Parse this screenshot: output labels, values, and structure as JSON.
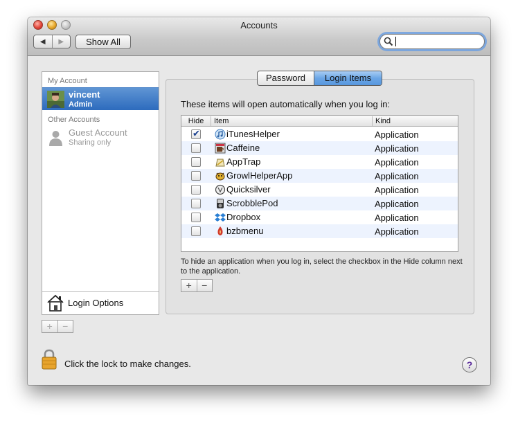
{
  "window": {
    "title": "Accounts"
  },
  "toolbar": {
    "back_icon": "◀",
    "forward_icon": "▶",
    "show_all_label": "Show All",
    "search_value": ""
  },
  "sidebar": {
    "my_account_header": "My Account",
    "current_user": {
      "name": "vincent",
      "role": "Admin"
    },
    "other_accounts_header": "Other Accounts",
    "guest": {
      "name": "Guest Account",
      "role": "Sharing only"
    },
    "login_options_label": "Login Options",
    "add_label": "+",
    "remove_label": "−"
  },
  "tabs": {
    "password": "Password",
    "login_items": "Login Items",
    "selected": "login_items"
  },
  "login_items": {
    "intro": "These items will open automatically when you log in:",
    "columns": {
      "hide": "Hide",
      "item": "Item",
      "kind": "Kind"
    },
    "rows": [
      {
        "hide": true,
        "name": "iTunesHelper",
        "kind": "Application",
        "icon": "itunes-helper-icon"
      },
      {
        "hide": false,
        "name": "Caffeine",
        "kind": "Application",
        "icon": "caffeine-icon"
      },
      {
        "hide": false,
        "name": "AppTrap",
        "kind": "Application",
        "icon": "apptrap-icon"
      },
      {
        "hide": false,
        "name": "GrowlHelperApp",
        "kind": "Application",
        "icon": "growl-icon"
      },
      {
        "hide": false,
        "name": "Quicksilver",
        "kind": "Application",
        "icon": "quicksilver-icon"
      },
      {
        "hide": false,
        "name": "ScrobblePod",
        "kind": "Application",
        "icon": "scrobblepod-icon"
      },
      {
        "hide": false,
        "name": "Dropbox",
        "kind": "Application",
        "icon": "dropbox-icon"
      },
      {
        "hide": false,
        "name": "bzbmenu",
        "kind": "Application",
        "icon": "bzbmenu-icon"
      }
    ],
    "help_text": "To hide an application when you log in, select the checkbox in the Hide column next to the application.",
    "add_label": "+",
    "remove_label": "−"
  },
  "footer": {
    "lock_text": "Click the lock to make changes.",
    "help_label": "?"
  },
  "colors": {
    "selection": "#3b76c4",
    "tab_selected": "#6ba6e6",
    "alt_row": "#edf3fe"
  }
}
